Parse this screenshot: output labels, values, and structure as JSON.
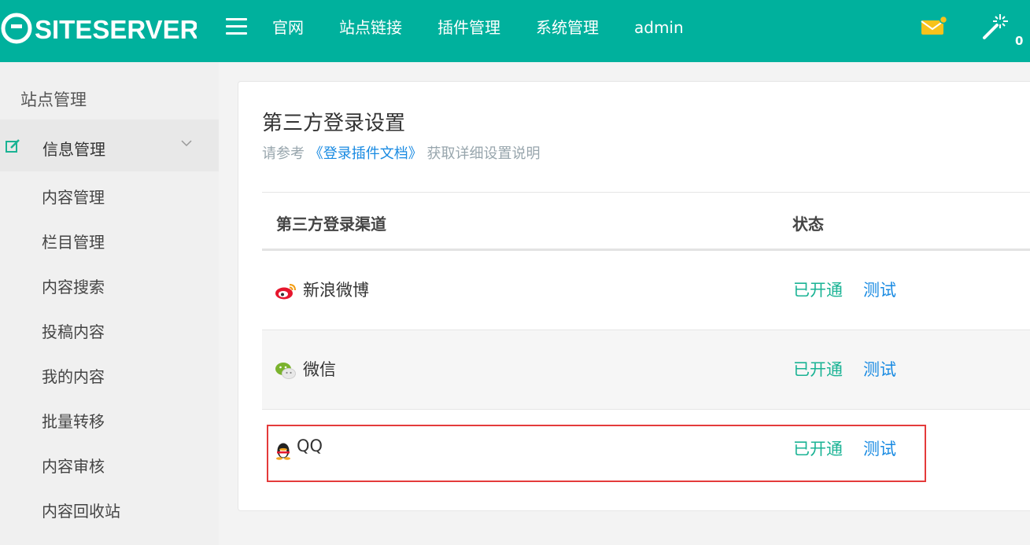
{
  "header": {
    "logo_text": "SITESERVER",
    "nav": [
      "官网",
      "站点链接",
      "插件管理",
      "系统管理",
      "admin"
    ],
    "notification_count": "0"
  },
  "sidebar": {
    "title": "站点管理",
    "group": {
      "label": "信息管理",
      "icon": "edit-icon",
      "expanded": true
    },
    "items": [
      "内容管理",
      "栏目管理",
      "内容搜索",
      "投稿内容",
      "我的内容",
      "批量转移",
      "内容审核",
      "内容回收站"
    ]
  },
  "main": {
    "title": "第三方登录设置",
    "subtitle_prefix": "请参考",
    "subtitle_link": "《登录插件文档》",
    "subtitle_suffix": "获取详细设置说明",
    "table": {
      "headers": [
        "第三方登录渠道",
        "状态"
      ],
      "rows": [
        {
          "icon": "weibo-icon",
          "name": "新浪微博",
          "status": "已开通",
          "action": "测试"
        },
        {
          "icon": "wechat-icon",
          "name": "微信",
          "status": "已开通",
          "action": "测试"
        },
        {
          "icon": "qq-icon",
          "name": "QQ",
          "status": "已开通",
          "action": "测试"
        }
      ]
    }
  },
  "colors": {
    "primary": "#00b19d",
    "status_green": "#1ab394",
    "link_blue": "#188ae2",
    "highlight_red": "#e43b3b"
  }
}
